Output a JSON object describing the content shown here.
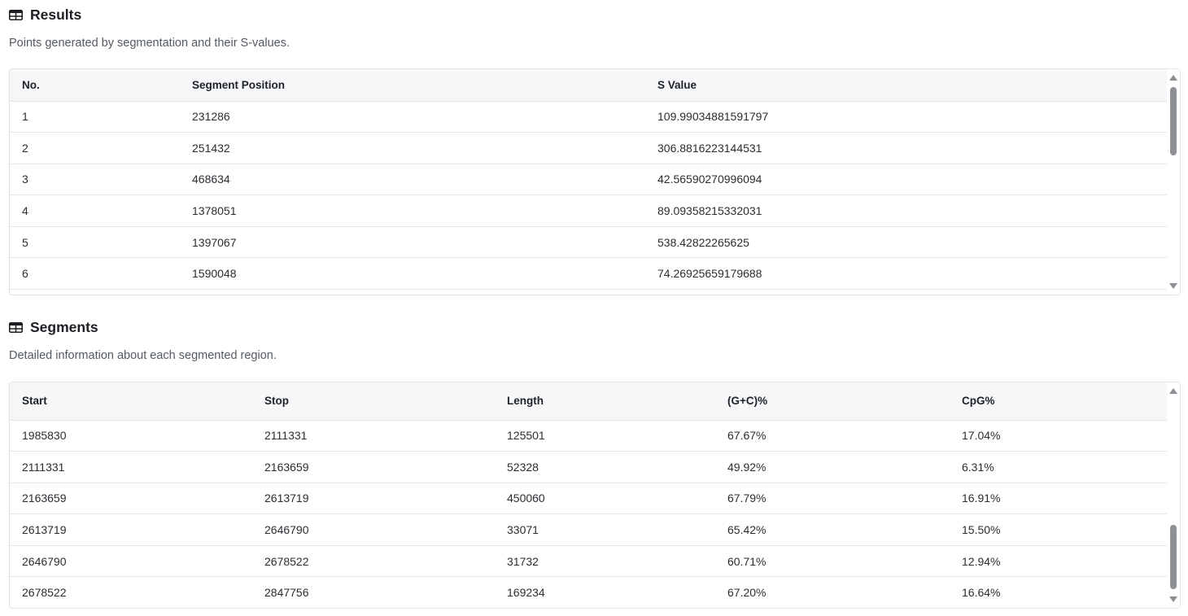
{
  "results": {
    "title": "Results",
    "description": "Points generated by segmentation and their S-values.",
    "icon": "table-icon",
    "columns": [
      "No.",
      "Segment Position",
      "S Value"
    ],
    "rows": [
      [
        "1",
        "231286",
        "109.99034881591797"
      ],
      [
        "2",
        "251432",
        "306.8816223144531"
      ],
      [
        "3",
        "468634",
        "42.56590270996094"
      ],
      [
        "4",
        "1378051",
        "89.09358215332031"
      ],
      [
        "5",
        "1397067",
        "538.42822265625"
      ],
      [
        "6",
        "1590048",
        "74.26925659179688"
      ]
    ]
  },
  "segments": {
    "title": "Segments",
    "description": "Detailed information about each segmented region.",
    "icon": "table-icon",
    "columns": [
      "Start",
      "Stop",
      "Length",
      "(G+C)%",
      "CpG%"
    ],
    "rows": [
      [
        "1985830",
        "2111331",
        "125501",
        "67.67%",
        "17.04%"
      ],
      [
        "2111331",
        "2163659",
        "52328",
        "49.92%",
        "6.31%"
      ],
      [
        "2163659",
        "2613719",
        "450060",
        "67.79%",
        "16.91%"
      ],
      [
        "2613719",
        "2646790",
        "33071",
        "65.42%",
        "15.50%"
      ],
      [
        "2646790",
        "2678522",
        "31732",
        "60.71%",
        "12.94%"
      ],
      [
        "2678522",
        "2847756",
        "169234",
        "67.20%",
        "16.64%"
      ]
    ]
  },
  "colors": {
    "header_bg": "#f6f7f9",
    "border": "#dfe2e6",
    "scroll_thumb": "#8d9197"
  }
}
